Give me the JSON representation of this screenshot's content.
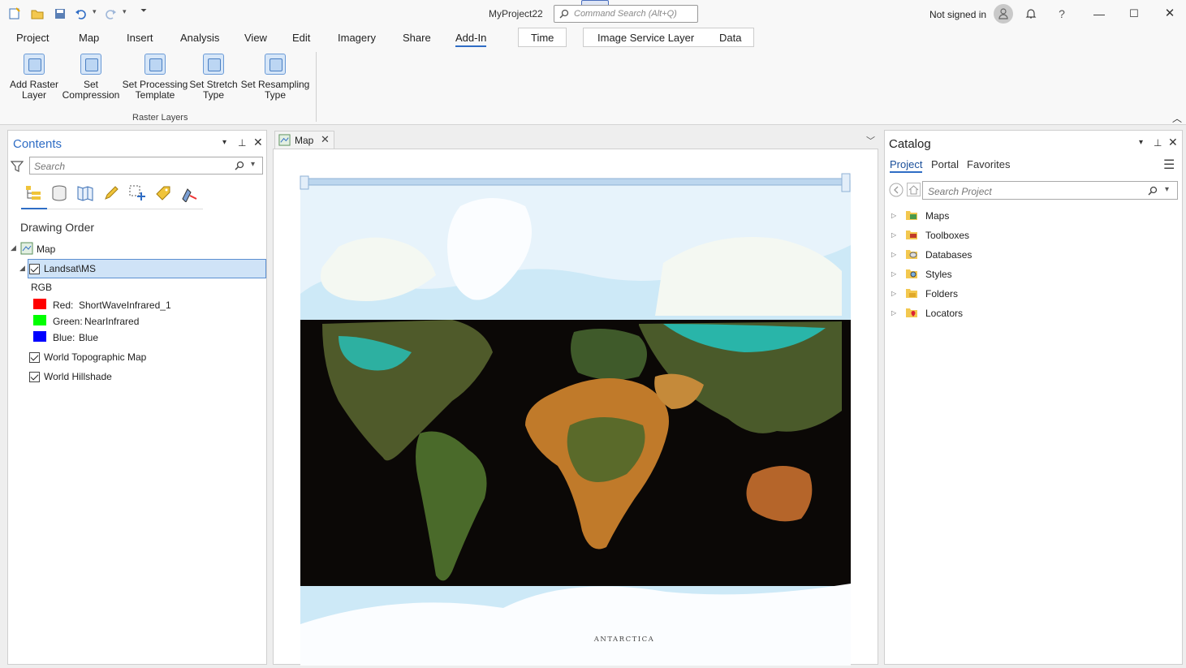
{
  "titlebar": {
    "app_title": "MyProject22",
    "command_search_placeholder": "Command Search (Alt+Q)",
    "signin_text": "Not signed in",
    "help_glyph": "?"
  },
  "ribbon": {
    "tabs": [
      "Project",
      "Map",
      "Insert",
      "Analysis",
      "View",
      "Edit",
      "Imagery",
      "Share",
      "Add-In"
    ],
    "active_tab": "Add-In",
    "contextual_tabs": [
      "Time",
      "Image Service Layer",
      "Data"
    ],
    "buttons": [
      {
        "line1": "Add Raster",
        "line2": "Layer"
      },
      {
        "line1": "Set",
        "line2": "Compression"
      },
      {
        "line1": "Set Processing",
        "line2": "Template"
      },
      {
        "line1": "Set Stretch",
        "line2": "Type"
      },
      {
        "line1": "Set Resampling",
        "line2": "Type"
      }
    ],
    "group_label": "Raster Layers"
  },
  "contents": {
    "title": "Contents",
    "search_placeholder": "Search",
    "section_title": "Drawing Order",
    "map_name": "Map",
    "layer_name": "Landsat\\MS",
    "rgb_label": "RGB",
    "bands": [
      {
        "label": "Red:",
        "value": "ShortWaveInfrared_1",
        "color": "#ff0000"
      },
      {
        "label": "Green:",
        "value": "NearInfrared",
        "color": "#00ff00"
      },
      {
        "label": "Blue:",
        "value": "Blue",
        "color": "#0000ff"
      }
    ],
    "other_layers": [
      "World Topographic Map",
      "World Hillshade"
    ]
  },
  "map_view": {
    "tab_label": "Map",
    "antarctica_label": "ANTARCTICA"
  },
  "catalog": {
    "title": "Catalog",
    "tabs": [
      "Project",
      "Portal",
      "Favorites"
    ],
    "active_tab": "Project",
    "search_placeholder": "Search Project",
    "items": [
      "Maps",
      "Toolboxes",
      "Databases",
      "Styles",
      "Folders",
      "Locators"
    ]
  },
  "colors": {
    "accent": "#2f6dc5",
    "selection": "#cfe3f7",
    "ocean": "#cde9f7",
    "imagery_bg": "#0b0806"
  }
}
